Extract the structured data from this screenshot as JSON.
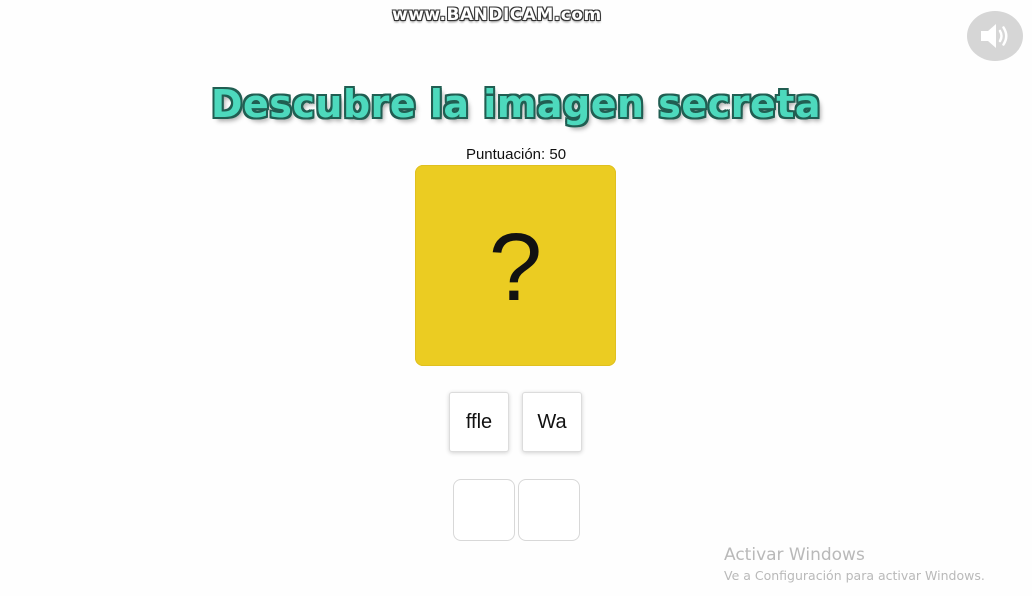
{
  "watermark": "www.BANDICAM.com",
  "sound_button": {
    "icon": "speaker-volume-icon"
  },
  "title": "Descubre la imagen secreta",
  "score": "Puntuación: 50",
  "mystery": {
    "symbol": "?",
    "color": "#ebcc22"
  },
  "tiles": [
    "ffle",
    "Wa"
  ],
  "answer_slots": [
    "",
    ""
  ],
  "os_notice": {
    "line1": "Activar Windows",
    "line2": "Ve a Configuración para activar Windows."
  },
  "colors": {
    "title_fill": "#4dd9bd",
    "title_outline": "#215e52",
    "mystery_bg": "#ebcc22"
  }
}
